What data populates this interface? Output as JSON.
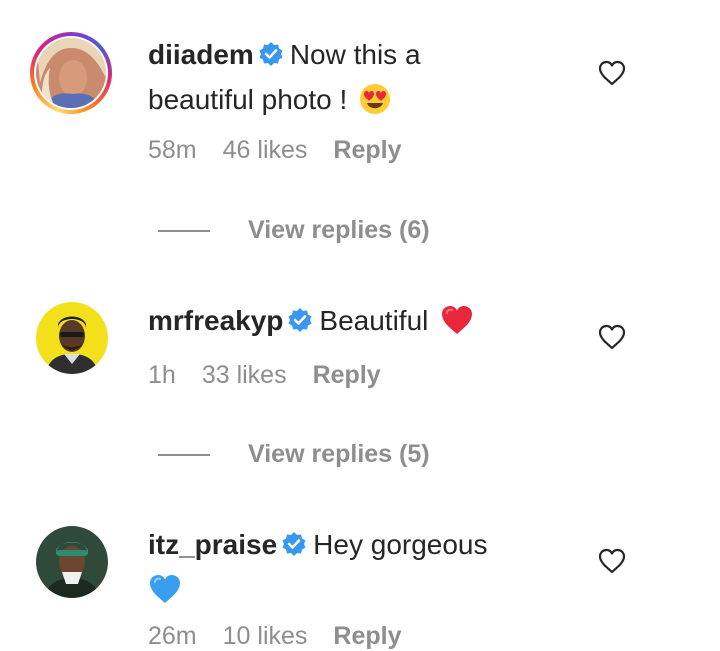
{
  "comments": [
    {
      "username": "diiadem",
      "text_line1": "Now this a",
      "text_line2": "beautiful photo !",
      "emoji_icon": "heart-eyes-emoji",
      "time": "58m",
      "likes": "46 likes",
      "reply_label": "Reply",
      "view_replies": "View replies (6)"
    },
    {
      "username": "mrfreakyp",
      "text_line1": "Beautiful",
      "emoji_icon": "red-heart-emoji",
      "time": "1h",
      "likes": "33 likes",
      "reply_label": "Reply",
      "view_replies": "View replies (5)"
    },
    {
      "username": "itz_praise",
      "text_line1": "Hey gorgeous",
      "emoji_icon": "blue-heart-emoji",
      "time": "26m",
      "likes": "10 likes",
      "reply_label": "Reply"
    }
  ],
  "colors": {
    "verified_blue": "#3897f0",
    "muted_gray": "#8e8e8e",
    "text": "#262626"
  }
}
